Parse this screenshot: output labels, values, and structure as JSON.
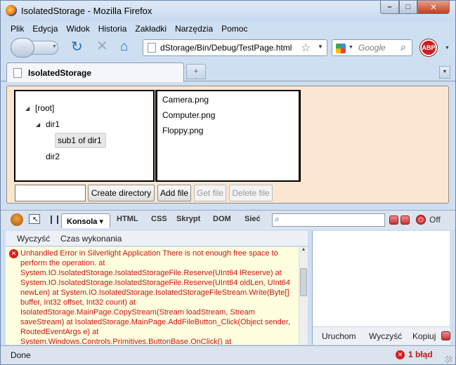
{
  "window": {
    "title": "IsolatedStorage - Mozilla Firefox",
    "controls": {
      "minimize": "–",
      "maximize": "□",
      "close": "✕"
    }
  },
  "menubar": {
    "items": [
      "Plik",
      "Edycja",
      "Widok",
      "Historia",
      "Zakładki",
      "Narzędzia",
      "Pomoc"
    ]
  },
  "navbar": {
    "url": "dStorage/Bin/Debug/TestPage.html",
    "search_placeholder": "Google",
    "adblock_label": "ABP",
    "reload_glyph": "↻",
    "stop_glyph": "✕",
    "home_glyph": "⌂",
    "star_glyph": "☆",
    "search_glyph": "⌕"
  },
  "tabs": [
    {
      "title": "IsolatedStorage"
    }
  ],
  "newtab_glyph": "+",
  "silverlight": {
    "tree": {
      "root": "[root]",
      "dir1": "dir1",
      "sub1": "sub1 of dir1",
      "dir2": "dir2",
      "toggle_glyph": "◢"
    },
    "files": [
      "Camera.png",
      "Computer.png",
      "Floppy.png"
    ],
    "input_value": "",
    "buttons": {
      "create_directory": "Create directory",
      "add_file": "Add file",
      "get_file": "Get file",
      "delete_file": "Delete file"
    }
  },
  "firebug": {
    "active_tab": "Konsola",
    "active_tab_arrow": "▾",
    "tabs": [
      "HTML",
      "CSS",
      "Skrypt",
      "DOM",
      "Sieć"
    ],
    "search_value": "",
    "off_label": "Off",
    "power_glyph": "⏻",
    "pause_glyph": "❙❙",
    "console_buttons": [
      "Wyczyść",
      "Czas wykonania"
    ],
    "error_message": "Unhandled Error in Silverlight Application There is not enough free space to perform the operation. at System.IO.IsolatedStorage.IsolatedStorageFile.Reserve(UInt64 lReserve) at System.IO.IsolatedStorage.IsolatedStorageFile.Reserve(UInt64 oldLen, UInt64 newLen) at System.IO.IsolatedStorage.IsolatedStorageFileStream.Write(Byte[] buffer, Int32 offset, Int32 count) at IsolatedStorage.MainPage.CopyStream(Stream loadStream, Stream saveStream) at IsolatedStorage.MainPage.AddFileButton_Click(Object sender, RoutedEventArgs e) at System.Windows.Controls.Primitives.ButtonBase.OnClick() at System.Windows.Controls.Button.OnClick() at",
    "error_glyph": "✕",
    "side_buttons": [
      "Uruchom",
      "Wyczyść",
      "Kopiuj"
    ]
  },
  "status": {
    "text": "Done",
    "error_count": "1 błąd"
  },
  "colors": {
    "error_red": "#d11010",
    "silverlight_bg": "#fbe6d2",
    "chrome_blue": "#cfdff2"
  }
}
